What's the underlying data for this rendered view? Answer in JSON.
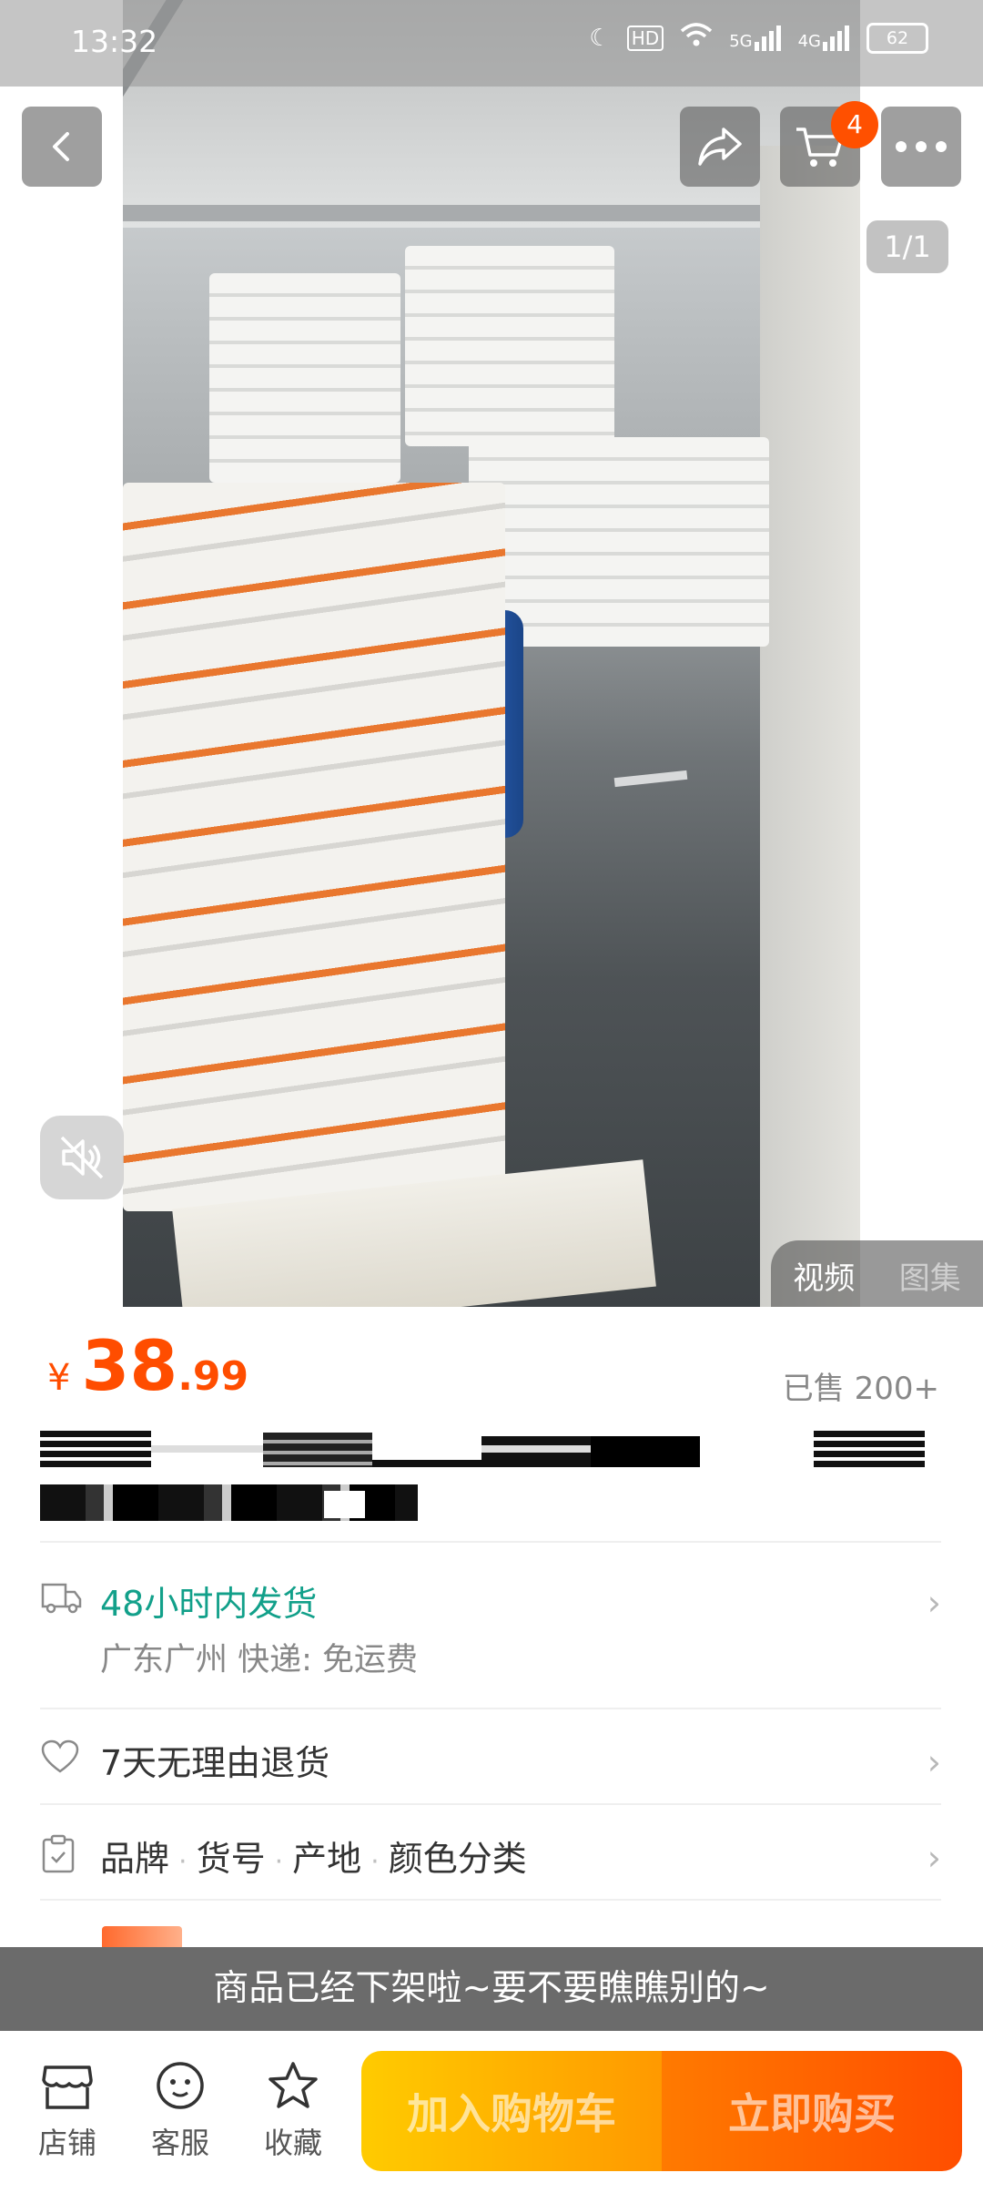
{
  "status_bar": {
    "time": "13:32",
    "hd_label": "HD",
    "signal_5g": "5G",
    "signal_4g": "4G",
    "battery": "62"
  },
  "nav": {
    "cart_badge": "4",
    "page_indicator": "1/1"
  },
  "media_tabs": {
    "video": "视频",
    "gallery": "图集"
  },
  "product": {
    "currency": "¥",
    "price_int": "38",
    "price_dec": ".99",
    "sold": "已售 200+"
  },
  "shipping": {
    "title": "48小时内发货",
    "subtitle": "广东广州  快递: 免运费"
  },
  "returns": {
    "label": "7天无理由退货"
  },
  "attributes": {
    "items": [
      "品牌",
      "货号",
      "产地",
      "颜色分类"
    ],
    "separator": "·"
  },
  "notice": "商品已经下架啦~要不要瞧瞧别的~",
  "bottom_bar": {
    "shop": "店铺",
    "service": "客服",
    "favorite": "收藏",
    "add_to_cart": "加入购物车",
    "buy_now": "立即购买"
  },
  "colors": {
    "price": "#ff4d00",
    "shipping_green": "#12a08a",
    "cart_button": "#ffb000",
    "buy_button": "#ff5a00"
  }
}
